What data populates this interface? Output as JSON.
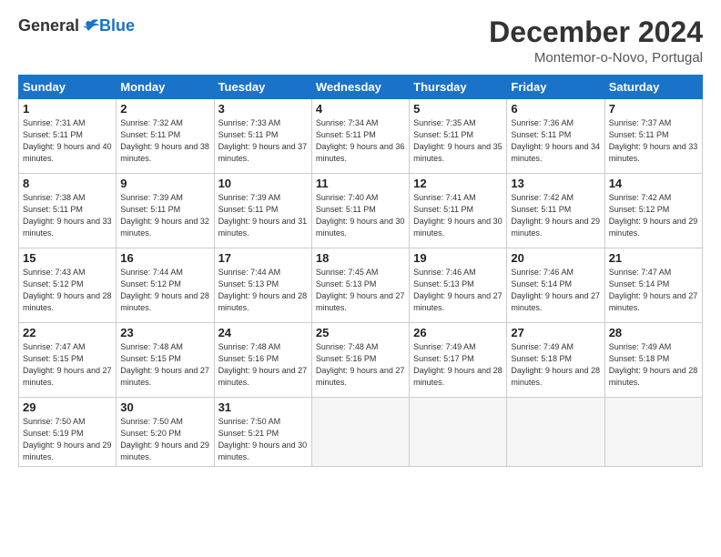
{
  "header": {
    "logo_general": "General",
    "logo_blue": "Blue",
    "title": "December 2024",
    "subtitle": "Montemor-o-Novo, Portugal"
  },
  "weekdays": [
    "Sunday",
    "Monday",
    "Tuesday",
    "Wednesday",
    "Thursday",
    "Friday",
    "Saturday"
  ],
  "weeks": [
    [
      {
        "day": "1",
        "sunrise": "7:31 AM",
        "sunset": "5:11 PM",
        "daylight": "9 hours and 40 minutes."
      },
      {
        "day": "2",
        "sunrise": "7:32 AM",
        "sunset": "5:11 PM",
        "daylight": "9 hours and 38 minutes."
      },
      {
        "day": "3",
        "sunrise": "7:33 AM",
        "sunset": "5:11 PM",
        "daylight": "9 hours and 37 minutes."
      },
      {
        "day": "4",
        "sunrise": "7:34 AM",
        "sunset": "5:11 PM",
        "daylight": "9 hours and 36 minutes."
      },
      {
        "day": "5",
        "sunrise": "7:35 AM",
        "sunset": "5:11 PM",
        "daylight": "9 hours and 35 minutes."
      },
      {
        "day": "6",
        "sunrise": "7:36 AM",
        "sunset": "5:11 PM",
        "daylight": "9 hours and 34 minutes."
      },
      {
        "day": "7",
        "sunrise": "7:37 AM",
        "sunset": "5:11 PM",
        "daylight": "9 hours and 33 minutes."
      }
    ],
    [
      {
        "day": "8",
        "sunrise": "7:38 AM",
        "sunset": "5:11 PM",
        "daylight": "9 hours and 33 minutes."
      },
      {
        "day": "9",
        "sunrise": "7:39 AM",
        "sunset": "5:11 PM",
        "daylight": "9 hours and 32 minutes."
      },
      {
        "day": "10",
        "sunrise": "7:39 AM",
        "sunset": "5:11 PM",
        "daylight": "9 hours and 31 minutes."
      },
      {
        "day": "11",
        "sunrise": "7:40 AM",
        "sunset": "5:11 PM",
        "daylight": "9 hours and 30 minutes."
      },
      {
        "day": "12",
        "sunrise": "7:41 AM",
        "sunset": "5:11 PM",
        "daylight": "9 hours and 30 minutes."
      },
      {
        "day": "13",
        "sunrise": "7:42 AM",
        "sunset": "5:11 PM",
        "daylight": "9 hours and 29 minutes."
      },
      {
        "day": "14",
        "sunrise": "7:42 AM",
        "sunset": "5:12 PM",
        "daylight": "9 hours and 29 minutes."
      }
    ],
    [
      {
        "day": "15",
        "sunrise": "7:43 AM",
        "sunset": "5:12 PM",
        "daylight": "9 hours and 28 minutes."
      },
      {
        "day": "16",
        "sunrise": "7:44 AM",
        "sunset": "5:12 PM",
        "daylight": "9 hours and 28 minutes."
      },
      {
        "day": "17",
        "sunrise": "7:44 AM",
        "sunset": "5:13 PM",
        "daylight": "9 hours and 28 minutes."
      },
      {
        "day": "18",
        "sunrise": "7:45 AM",
        "sunset": "5:13 PM",
        "daylight": "9 hours and 27 minutes."
      },
      {
        "day": "19",
        "sunrise": "7:46 AM",
        "sunset": "5:13 PM",
        "daylight": "9 hours and 27 minutes."
      },
      {
        "day": "20",
        "sunrise": "7:46 AM",
        "sunset": "5:14 PM",
        "daylight": "9 hours and 27 minutes."
      },
      {
        "day": "21",
        "sunrise": "7:47 AM",
        "sunset": "5:14 PM",
        "daylight": "9 hours and 27 minutes."
      }
    ],
    [
      {
        "day": "22",
        "sunrise": "7:47 AM",
        "sunset": "5:15 PM",
        "daylight": "9 hours and 27 minutes."
      },
      {
        "day": "23",
        "sunrise": "7:48 AM",
        "sunset": "5:15 PM",
        "daylight": "9 hours and 27 minutes."
      },
      {
        "day": "24",
        "sunrise": "7:48 AM",
        "sunset": "5:16 PM",
        "daylight": "9 hours and 27 minutes."
      },
      {
        "day": "25",
        "sunrise": "7:48 AM",
        "sunset": "5:16 PM",
        "daylight": "9 hours and 27 minutes."
      },
      {
        "day": "26",
        "sunrise": "7:49 AM",
        "sunset": "5:17 PM",
        "daylight": "9 hours and 28 minutes."
      },
      {
        "day": "27",
        "sunrise": "7:49 AM",
        "sunset": "5:18 PM",
        "daylight": "9 hours and 28 minutes."
      },
      {
        "day": "28",
        "sunrise": "7:49 AM",
        "sunset": "5:18 PM",
        "daylight": "9 hours and 28 minutes."
      }
    ],
    [
      {
        "day": "29",
        "sunrise": "7:50 AM",
        "sunset": "5:19 PM",
        "daylight": "9 hours and 29 minutes."
      },
      {
        "day": "30",
        "sunrise": "7:50 AM",
        "sunset": "5:20 PM",
        "daylight": "9 hours and 29 minutes."
      },
      {
        "day": "31",
        "sunrise": "7:50 AM",
        "sunset": "5:21 PM",
        "daylight": "9 hours and 30 minutes."
      },
      null,
      null,
      null,
      null
    ]
  ]
}
